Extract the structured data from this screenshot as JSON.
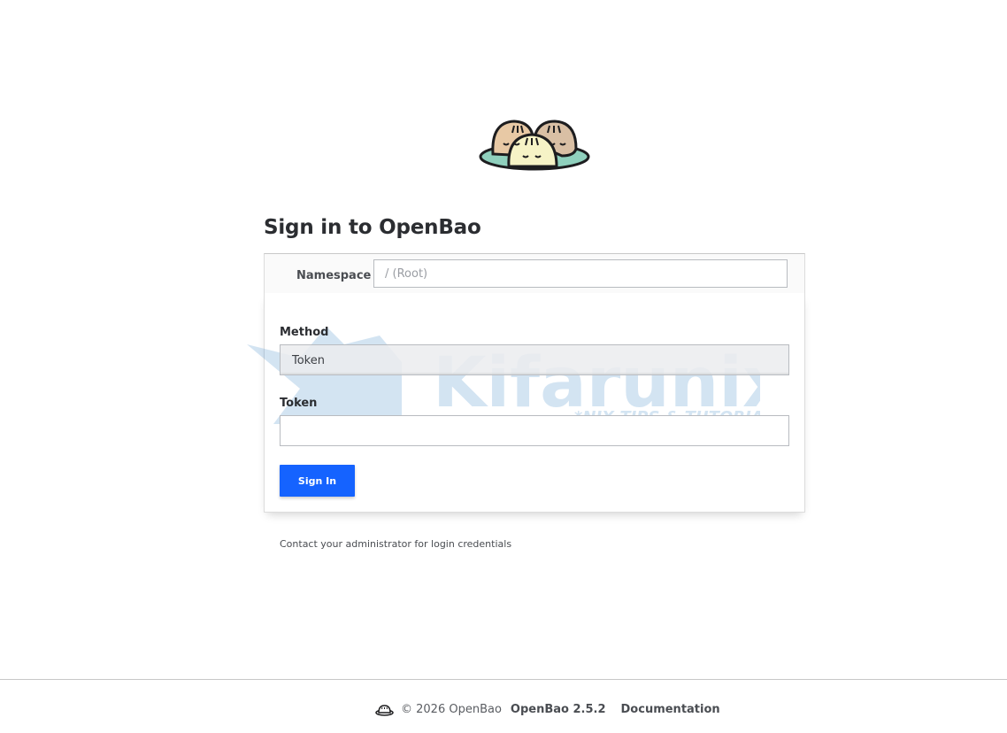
{
  "logo": {
    "name": "openbao-logo",
    "colors": {
      "plate": "#8fd0bd",
      "bun_left": "#e8c9a5",
      "bun_right": "#d9bfa4",
      "bun_front": "#f6f3c6",
      "outline": "#1d1d1f"
    }
  },
  "page": {
    "title": "Sign in to OpenBao"
  },
  "namespace": {
    "label": "Namespace",
    "placeholder": "/ (Root)",
    "value": ""
  },
  "method": {
    "label": "Method",
    "selected": "Token"
  },
  "token": {
    "label": "Token",
    "value": ""
  },
  "signin": {
    "button_label": "Sign In",
    "color": "#1563ff"
  },
  "help": {
    "text": "Contact your administrator for login credentials"
  },
  "watermark": {
    "brand": "Kifarunix",
    "tagline": "*NIX TIPS & TUTORIALS"
  },
  "footer": {
    "copyright": "© 2026 OpenBao",
    "version": "OpenBao 2.5.2",
    "docs_link": "Documentation"
  }
}
